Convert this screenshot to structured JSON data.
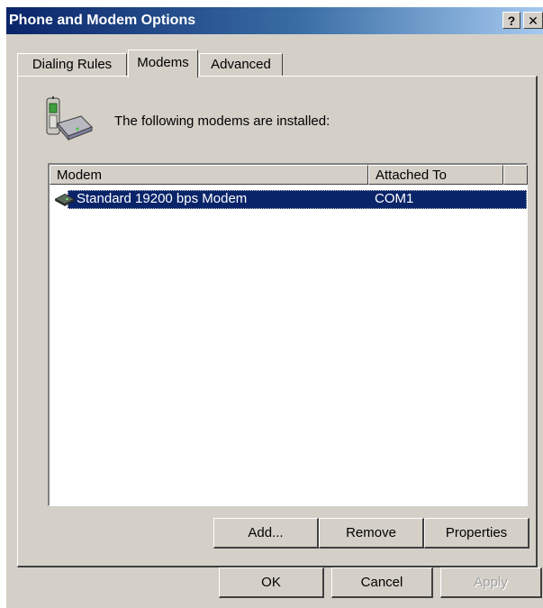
{
  "window": {
    "title": "Phone and Modem Options",
    "help_btn": "?",
    "close_btn": "✕"
  },
  "tabs": [
    {
      "label": "Dialing Rules",
      "active": false
    },
    {
      "label": "Modems",
      "active": true
    },
    {
      "label": "Advanced",
      "active": false
    }
  ],
  "intro": {
    "text": "The following modems are  installed:",
    "icon": "phone-modem-icon"
  },
  "modem_list": {
    "columns": [
      "Modem",
      "Attached To"
    ],
    "rows": [
      {
        "modem": "Standard 19200 bps Modem",
        "attached_to": "COM1",
        "selected": true,
        "icon": "modem-icon"
      }
    ]
  },
  "buttons": {
    "add": "Add...",
    "remove": "Remove",
    "properties": "Properties",
    "ok": "OK",
    "cancel": "Cancel",
    "apply": "Apply"
  },
  "colors": {
    "titlebar_start": "#0a246a",
    "titlebar_end": "#a6caf0",
    "selection": "#0a246a",
    "face": "#d4d0c8"
  }
}
